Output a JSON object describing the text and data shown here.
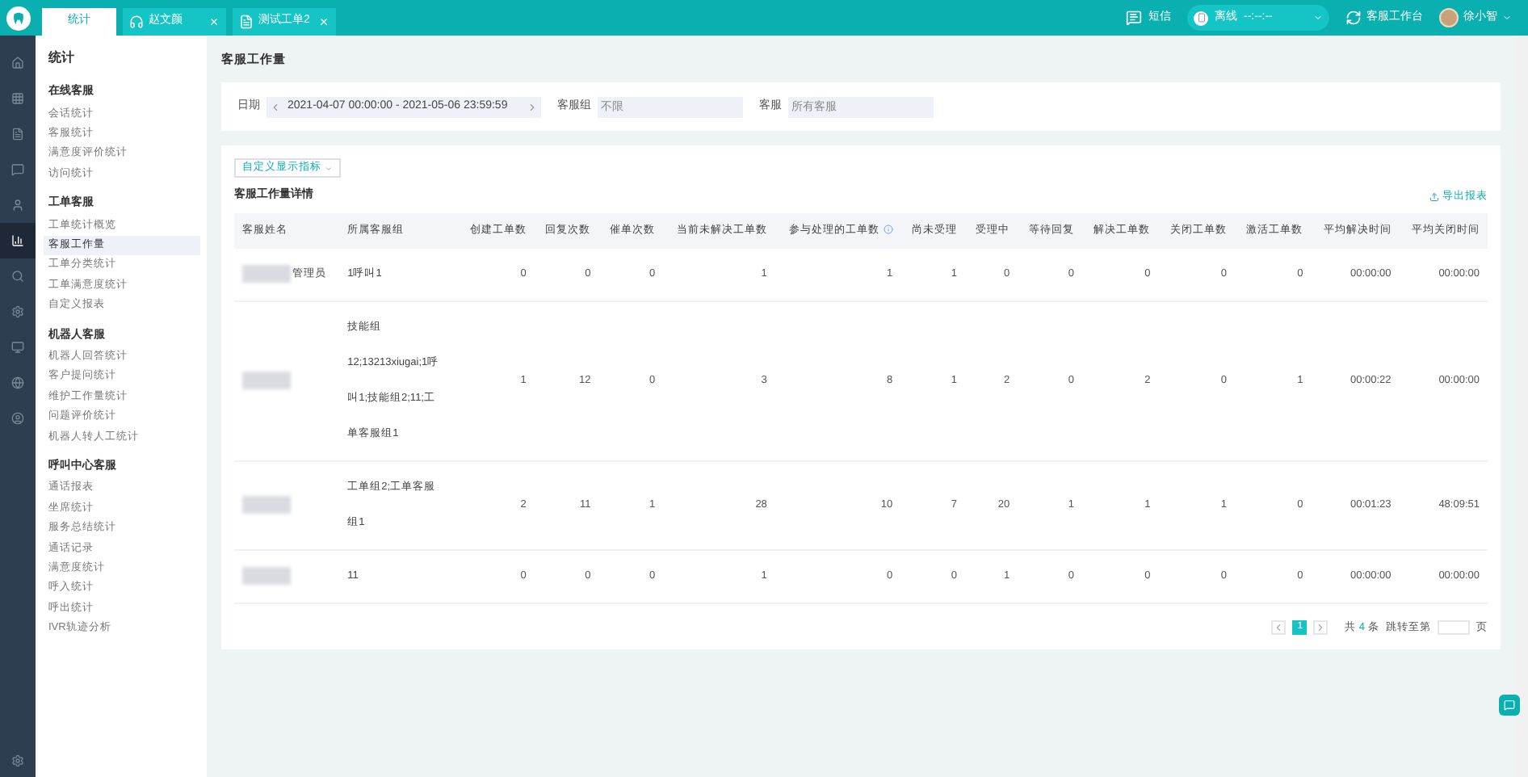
{
  "tabs": [
    {
      "label": "统计",
      "selected": true,
      "kind": "plain"
    },
    {
      "label": "赵文颜",
      "selected": false,
      "kind": "closable"
    },
    {
      "label": "测试工单2",
      "selected": false,
      "kind": "closable"
    }
  ],
  "header": {
    "sms": "短信",
    "status": "离线",
    "timer": "--:--:--",
    "workbench": "客服工作台",
    "user": "徐小智"
  },
  "rail": [
    {
      "selected": false
    },
    {
      "selected": false
    },
    {
      "selected": false
    },
    {
      "selected": false
    },
    {
      "selected": false
    },
    {
      "selected": true
    },
    {
      "selected": false
    },
    {
      "selected": false
    },
    {
      "selected": false
    },
    {
      "selected": false
    },
    {
      "selected": false
    }
  ],
  "menu": {
    "title": "统计",
    "sections": [
      {
        "title": "在线客服",
        "items": [
          {
            "label": "会话统计",
            "selected": false
          },
          {
            "label": "客服统计",
            "selected": false
          },
          {
            "label": "满意度评价统计",
            "selected": false
          },
          {
            "label": "访问统计",
            "selected": false
          }
        ]
      },
      {
        "title": "工单客服",
        "items": [
          {
            "label": "工单统计概览",
            "selected": false
          },
          {
            "label": "客服工作量",
            "selected": true
          },
          {
            "label": "工单分类统计",
            "selected": false
          },
          {
            "label": "工单满意度统计",
            "selected": false
          },
          {
            "label": "自定义报表",
            "selected": false
          }
        ]
      },
      {
        "title": "机器人客服",
        "items": [
          {
            "label": "机器人回答统计",
            "selected": false
          },
          {
            "label": "客户提问统计",
            "selected": false
          },
          {
            "label": "维护工作量统计",
            "selected": false
          },
          {
            "label": "问题评价统计",
            "selected": false
          },
          {
            "label": "机器人转人工统计",
            "selected": false
          }
        ]
      },
      {
        "title": "呼叫中心客服",
        "items": [
          {
            "label": "通话报表",
            "selected": false
          },
          {
            "label": "坐席统计",
            "selected": false
          },
          {
            "label": "服务总结统计",
            "selected": false
          },
          {
            "label": "通话记录",
            "selected": false
          },
          {
            "label": "满意度统计",
            "selected": false
          },
          {
            "label": "呼入统计",
            "selected": false
          },
          {
            "label": "呼出统计",
            "selected": false
          },
          {
            "label": "IVR轨迹分析",
            "selected": false
          }
        ]
      }
    ]
  },
  "page_title": "客服工作量",
  "filters": {
    "date_label": "日期",
    "date_value": "2021-04-07 00:00:00 - 2021-05-06 23:59:59",
    "group_label": "客服组",
    "group_placeholder": "不限",
    "agent_label": "客服",
    "agent_placeholder": "所有客服"
  },
  "custom_button": "自定义显示指标",
  "table": {
    "title": "客服工作量详情",
    "export": "导出报表",
    "columns": [
      {
        "label": "客服姓名",
        "info": false
      },
      {
        "label": "所属客服组",
        "info": false
      },
      {
        "label": "创建工单数",
        "info": false
      },
      {
        "label": "回复次数",
        "info": false
      },
      {
        "label": "催单次数",
        "info": false
      },
      {
        "label": "当前未解决工单数",
        "info": false
      },
      {
        "label": "参与处理的工单数",
        "info": true
      },
      {
        "label": "尚未受理",
        "info": false
      },
      {
        "label": "受理中",
        "info": false
      },
      {
        "label": "等待回复",
        "info": false
      },
      {
        "label": "解决工单数",
        "info": false
      },
      {
        "label": "关闭工单数",
        "info": false
      },
      {
        "label": "激活工单数",
        "info": false
      },
      {
        "label": "平均解决时间",
        "info": false
      },
      {
        "label": "平均关闭时间",
        "info": false
      }
    ],
    "rows": [
      {
        "cells": [
          "管理员",
          "1呼叫1",
          "0",
          "0",
          "0",
          "1",
          "1",
          "1",
          "0",
          "0",
          "0",
          "0",
          "0",
          "00:00:00",
          "00:00:00"
        ]
      },
      {
        "cells": [
          "",
          "技能组12;13213xiugai;1呼叫1;技能组2;11;工单客服组1",
          "1",
          "12",
          "0",
          "3",
          "8",
          "1",
          "2",
          "0",
          "2",
          "0",
          "1",
          "00:00:22",
          "00:00:00"
        ]
      },
      {
        "cells": [
          "",
          "工单组2;工单客服组1",
          "2",
          "11",
          "1",
          "28",
          "10",
          "7",
          "20",
          "1",
          "1",
          "1",
          "0",
          "00:01:23",
          "48:09:51"
        ]
      },
      {
        "cells": [
          "",
          "11",
          "0",
          "0",
          "0",
          "1",
          "0",
          "0",
          "1",
          "0",
          "0",
          "0",
          "0",
          "00:00:00",
          "00:00:00"
        ]
      }
    ]
  },
  "pagination": {
    "pages": [
      {
        "label": "1",
        "selected": true
      }
    ],
    "total_prefix": "共",
    "total_count": "4",
    "total_suffix": "条",
    "jump_label": "跳转至第",
    "page_suffix": "页"
  }
}
